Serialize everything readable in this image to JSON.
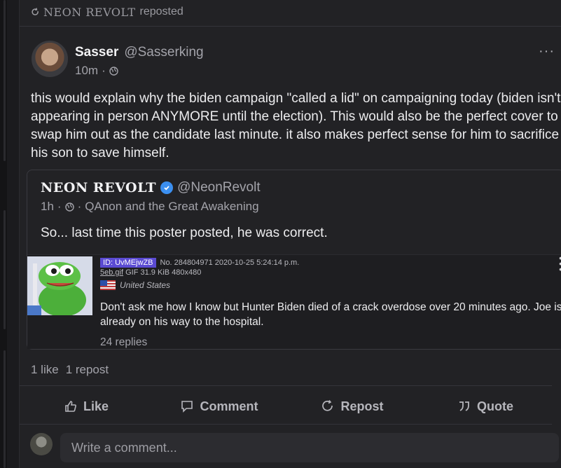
{
  "repost": {
    "name": "NEON REVOLT",
    "label": "reposted"
  },
  "post": {
    "author_name": "Sasser",
    "author_handle": "@Sasserking",
    "time": "10m",
    "more": "···",
    "body": "this would explain why the biden campaign \"called a lid\" on campaigning today (biden isn't appearing in person ANYMORE until the election). This would also be the perfect cover to swap him out as the candidate last minute. it also makes perfect sense for him to sacrifice his son to save himself."
  },
  "quote": {
    "author_name": "NEON REVOLT",
    "author_handle": "@NeonRevolt",
    "time": "1h",
    "group": "QAnon and the Great Awakening",
    "text": "So... last time this poster posted, he was correct.",
    "chan": {
      "id": "ID: UvMEjwZB",
      "post_meta": "No. 284804971 2020-10-25 5:24:14 p.m.",
      "file_name": "5eb.gif",
      "file_info": "GIF 31.9 KiB 480x480",
      "country": "United States",
      "text": "Don't ask me how I know but Hunter Biden died of a crack overdose over 20 minutes ago. Joe is already on his way to the hospital.",
      "replies": "24 replies"
    }
  },
  "stats": {
    "likes": "1 like",
    "reposts": "1 repost"
  },
  "actions": {
    "like": "Like",
    "comment": "Comment",
    "repost": "Repost",
    "quote": "Quote"
  },
  "comment": {
    "placeholder": "Write a comment..."
  }
}
